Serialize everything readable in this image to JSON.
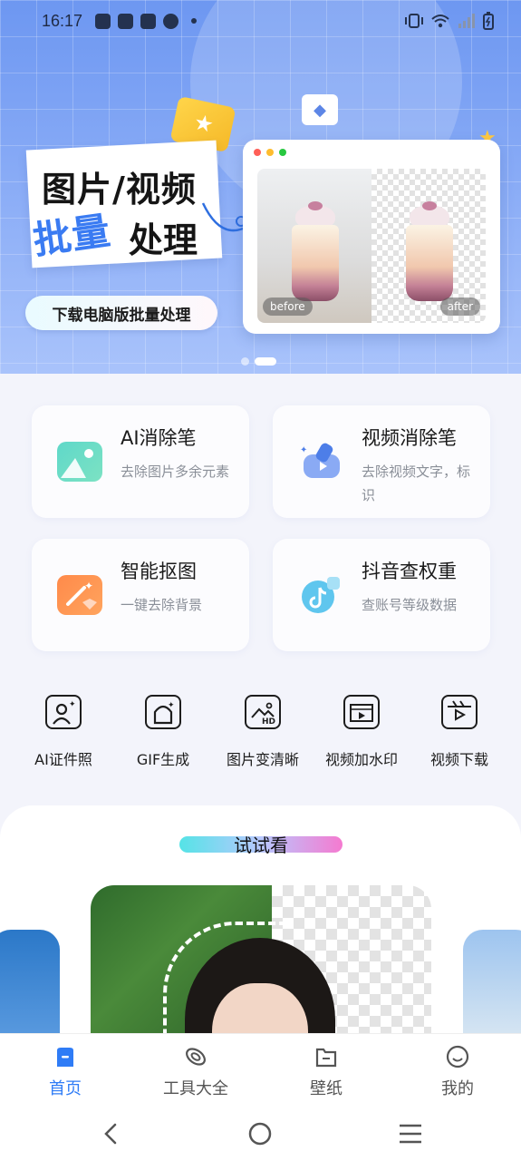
{
  "status_bar": {
    "time": "16:17"
  },
  "banner": {
    "title_line1": "图片/视频",
    "title_line2a": "批量",
    "title_line2b": "处理",
    "download_button": "下载电脑版批量处理",
    "before_label": "before",
    "after_label": "after",
    "carousel_pages": 2,
    "carousel_active_index": 1
  },
  "features": [
    {
      "title": "AI消除笔",
      "subtitle": "去除图片多余元素",
      "icon": "eraser-image-icon"
    },
    {
      "title": "视频消除笔",
      "subtitle": "去除视频文字，标识",
      "icon": "video-eraser-icon"
    },
    {
      "title": "智能抠图",
      "subtitle": "一键去除背景",
      "icon": "magic-wand-icon"
    },
    {
      "title": "抖音查权重",
      "subtitle": "查账号等级数据",
      "icon": "douyin-icon"
    }
  ],
  "tools": [
    {
      "label": "AI证件照",
      "icon": "id-photo-icon"
    },
    {
      "label": "GIF生成",
      "icon": "gif-icon"
    },
    {
      "label": "图片变清晰",
      "icon": "hd-image-icon"
    },
    {
      "label": "视频加水印",
      "icon": "video-watermark-icon"
    },
    {
      "label": "视频下载",
      "icon": "video-download-icon"
    }
  ],
  "try_section": {
    "title": "试试看"
  },
  "bottom_nav": [
    {
      "label": "首页",
      "icon": "home-icon",
      "active": true
    },
    {
      "label": "工具大全",
      "icon": "tools-icon",
      "active": false
    },
    {
      "label": "壁纸",
      "icon": "wallpaper-icon",
      "active": false
    },
    {
      "label": "我的",
      "icon": "profile-icon",
      "active": false
    }
  ],
  "colors": {
    "accent": "#2f7cf6",
    "banner_top": "#6d97f1",
    "title_blue": "#3a7bf2",
    "muted_text": "#8a8f98"
  }
}
